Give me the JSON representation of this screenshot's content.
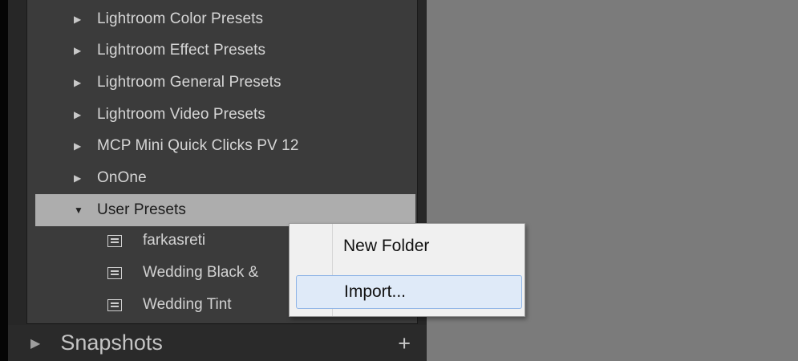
{
  "presets": {
    "folders": [
      {
        "label": "Lightroom Color Presets",
        "expanded": false
      },
      {
        "label": "Lightroom Effect Presets",
        "expanded": false
      },
      {
        "label": "Lightroom General Presets",
        "expanded": false
      },
      {
        "label": "Lightroom Video Presets",
        "expanded": false
      },
      {
        "label": "MCP Mini Quick Clicks PV 12",
        "expanded": false
      },
      {
        "label": "OnOne",
        "expanded": false
      },
      {
        "label": "User Presets",
        "expanded": true,
        "selected": true
      }
    ],
    "user_presets_items": [
      {
        "label": "farkasreti"
      },
      {
        "label": "Wedding Black &"
      },
      {
        "label": "Wedding Tint"
      }
    ]
  },
  "snapshots": {
    "label": "Snapshots",
    "add_label": "+"
  },
  "context_menu": {
    "items": [
      {
        "label": "New Folder"
      },
      {
        "label": "Import..."
      }
    ]
  },
  "icons": {
    "collapsed": "triangle-right-icon",
    "expanded": "triangle-down-icon",
    "preset": "preset-grid-icon",
    "add": "plus-icon"
  },
  "colors": {
    "panel_bg": "#3b3b3b",
    "selected_bg": "#adadad",
    "canvas_bg": "#7b7b7b",
    "menu_bg": "#f0f0f0",
    "menu_highlight": "#dfeaf8"
  }
}
